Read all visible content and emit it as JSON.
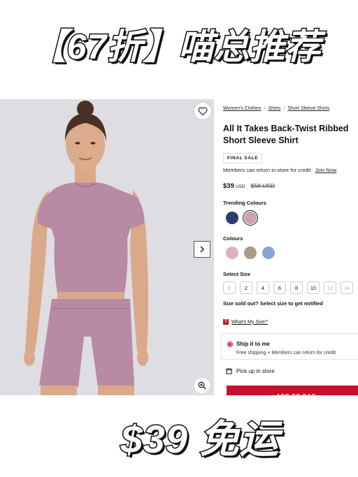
{
  "banner_top": {
    "text": "【67折】喵总推荐"
  },
  "banner_bottom": {
    "text": "$39 免运"
  },
  "breadcrumb": [
    {
      "label": "Women's Clothes"
    },
    {
      "label": "Shirts"
    },
    {
      "label": "Short Sleeve Shirts"
    }
  ],
  "product": {
    "title": "All It Takes Back-Twist Ribbed Short Sleeve Shirt",
    "badge": "FINAL SALE",
    "return_note": "Members can return in-store for credit",
    "join_label": "Join Now",
    "price_now": "$39",
    "currency": "USD",
    "price_was": "$58 USD"
  },
  "trending": {
    "label": "Trending Colours",
    "swatches": [
      {
        "icon": "navy-swatch",
        "color": "#2a3f6e"
      },
      {
        "icon": "mauve-swatch",
        "color": "#caa3ae",
        "selected": true
      }
    ]
  },
  "colours": {
    "label": "Colours",
    "swatches": [
      {
        "icon": "pink-swatch",
        "color": "#dcb3bd"
      },
      {
        "icon": "taupe-swatch",
        "color": "#a99c84"
      },
      {
        "icon": "blue-swatch",
        "color": "#8aa4d0"
      }
    ]
  },
  "sizes": {
    "label": "Select Size",
    "options": [
      "0",
      "2",
      "4",
      "6",
      "8",
      "10",
      "12",
      "14"
    ],
    "sold_out_note": "Size sold out? Select size to get notified"
  },
  "fit_link": "What's My Size?",
  "shipping": {
    "title": "Ship it to me",
    "subtitle": "Free shipping + Members can return for credit"
  },
  "pickup_label": "Pick up in store",
  "add_to_bag": "ADD TO BAG",
  "colors": {
    "accent": "#c8102e",
    "garment": "#b98aa3"
  }
}
